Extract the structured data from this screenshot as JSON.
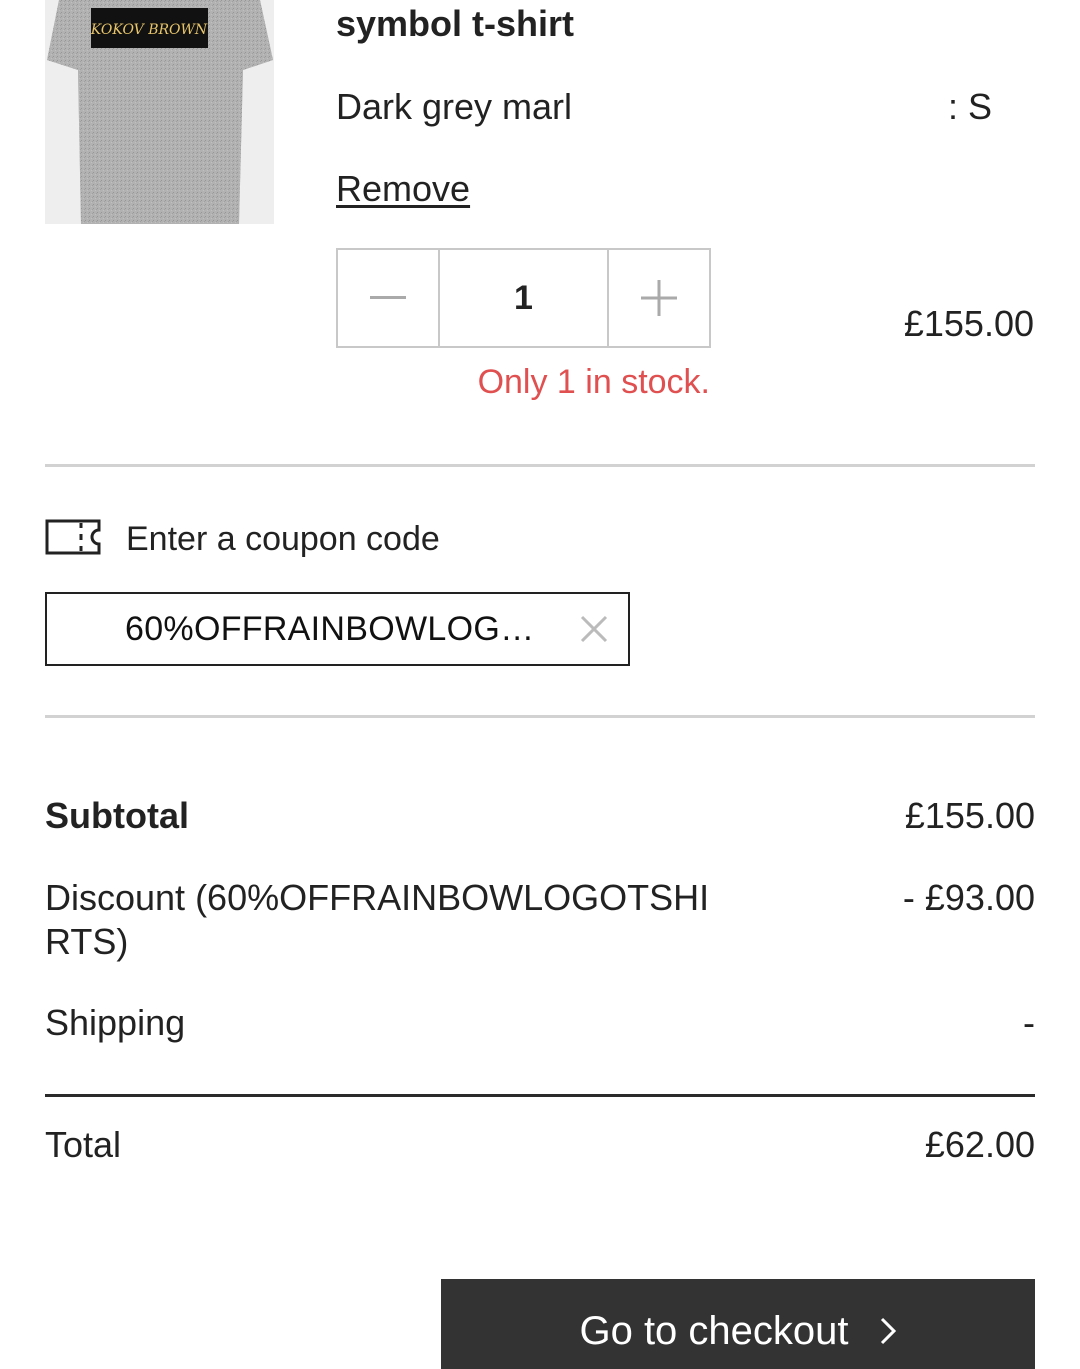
{
  "product": {
    "title": "symbol t-shirt",
    "image_print_text": "KOKOV BROWN",
    "variant": "Dark grey marl",
    "size": ": S",
    "remove_label": "Remove",
    "quantity": "1",
    "price": "£155.00",
    "stock_warning": "Only 1 in stock."
  },
  "coupon": {
    "label": "Enter a coupon code",
    "value": "60%OFFRAINBOWLOGO..."
  },
  "summary": {
    "subtotal_label": "Subtotal",
    "subtotal_value": "£155.00",
    "discount_label": "Discount (60%OFFRAINBOWLOGOTSHIRTS)",
    "discount_value": "- £93.00",
    "shipping_label": "Shipping",
    "shipping_value": "-",
    "total_label": "Total",
    "total_value": "£62.00"
  },
  "checkout": {
    "label": "Go to checkout"
  },
  "icons": {
    "decrease": "minus-icon",
    "increase": "plus-icon",
    "coupon": "ticket-icon",
    "clear": "close-icon",
    "checkout": "chevron-right-icon"
  },
  "colors": {
    "stock_warning": "#e05050",
    "checkout_button": "#333333",
    "border": "#c8c8c8"
  }
}
